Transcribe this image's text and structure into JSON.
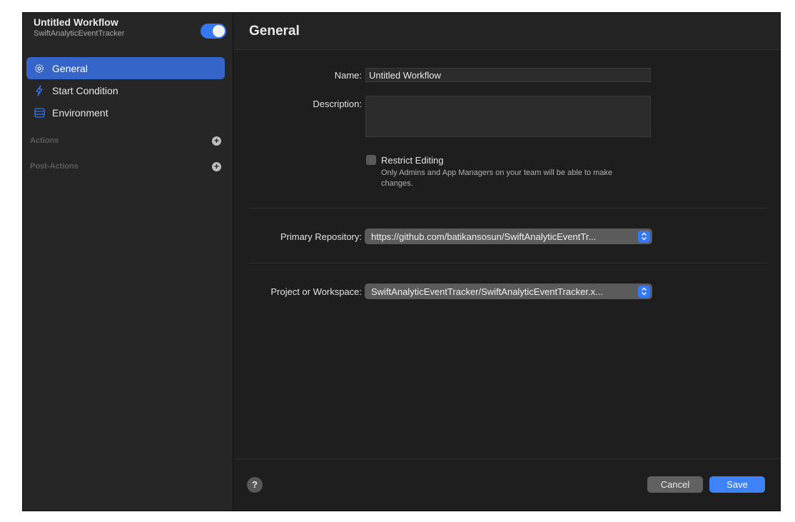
{
  "workflow": {
    "title": "Untitled Workflow",
    "subtitle": "SwiftAnalyticEventTracker",
    "enabled": true
  },
  "sidebar": {
    "items": [
      {
        "label": "General",
        "icon": "gear-icon",
        "active": true
      },
      {
        "label": "Start Condition",
        "icon": "bolt-icon",
        "active": false
      },
      {
        "label": "Environment",
        "icon": "stack-icon",
        "active": false
      }
    ],
    "sections": [
      {
        "label": "Actions"
      },
      {
        "label": "Post-Actions"
      }
    ]
  },
  "main": {
    "title": "General",
    "name_label": "Name:",
    "name_value": "Untitled Workflow",
    "description_label": "Description:",
    "description_value": "",
    "restrict_label": "Restrict Editing",
    "restrict_help": "Only Admins and App Managers on your team will be able to make changes.",
    "restrict_checked": false,
    "repo_label": "Primary Repository:",
    "repo_value": "https://github.com/batikansosun/SwiftAnalyticEventTr...",
    "project_label": "Project or Workspace:",
    "project_value": "SwiftAnalyticEventTracker/SwiftAnalyticEventTracker.x..."
  },
  "footer": {
    "help_label": "?",
    "cancel_label": "Cancel",
    "save_label": "Save"
  },
  "colors": {
    "accent": "#3478f6",
    "sidebar_bg": "#262626",
    "main_bg": "#1e1e1e"
  }
}
